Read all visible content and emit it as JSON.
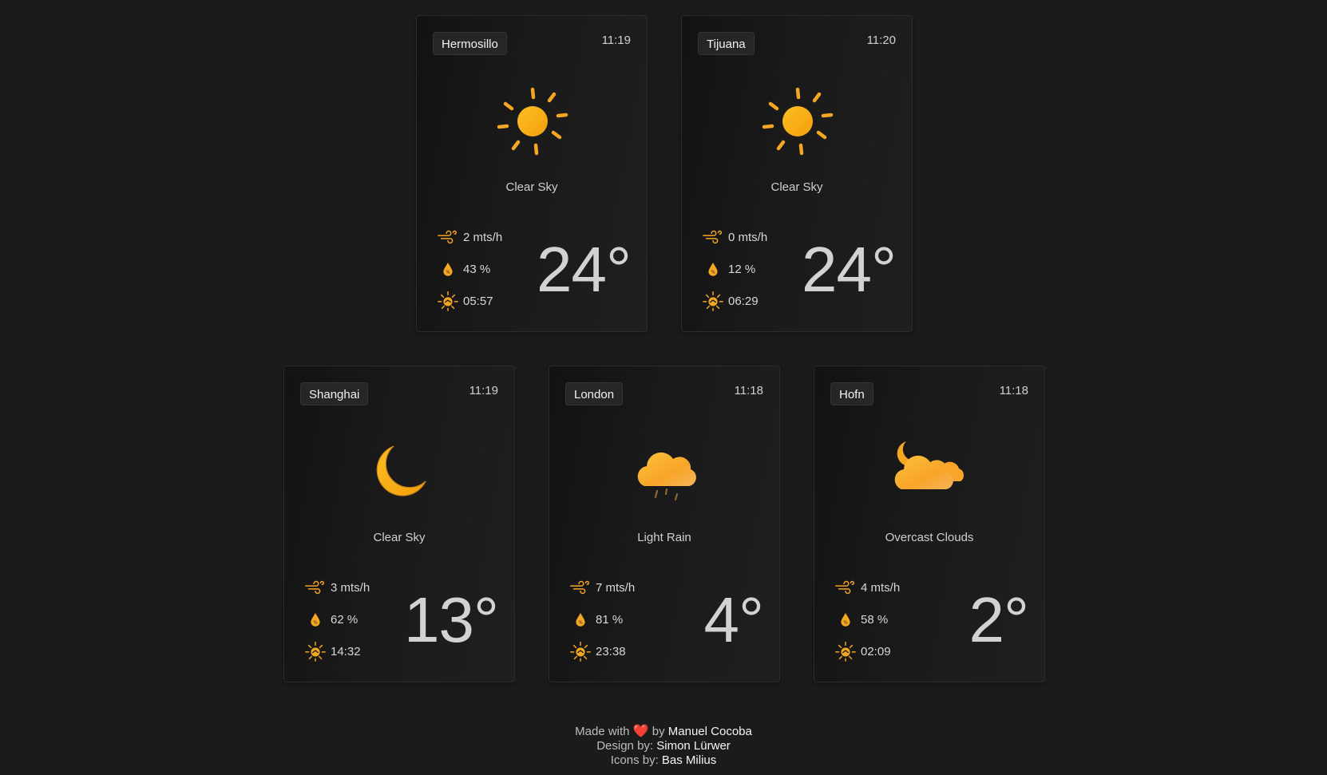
{
  "cards": [
    {
      "city": "Hermosillo",
      "time": "11:19",
      "icon": "sun-icon",
      "description": "Clear Sky",
      "wind": "2 mts/h",
      "humidity": "43 %",
      "sunrise": "05:57",
      "temperature": "24°"
    },
    {
      "city": "Tijuana",
      "time": "11:20",
      "icon": "sun-icon",
      "description": "Clear Sky",
      "wind": "0 mts/h",
      "humidity": "12 %",
      "sunrise": "06:29",
      "temperature": "24°"
    },
    {
      "city": "Shanghai",
      "time": "11:19",
      "icon": "moon-icon",
      "description": "Clear Sky",
      "wind": "3 mts/h",
      "humidity": "62 %",
      "sunrise": "14:32",
      "temperature": "13°"
    },
    {
      "city": "London",
      "time": "11:18",
      "icon": "rain-cloud-icon",
      "description": "Light Rain",
      "wind": "7 mts/h",
      "humidity": "81 %",
      "sunrise": "23:38",
      "temperature": "4°"
    },
    {
      "city": "Hofn",
      "time": "11:18",
      "icon": "overcast-night-cloud-icon",
      "description": "Overcast Clouds",
      "wind": "4 mts/h",
      "humidity": "58 %",
      "sunrise": "02:09",
      "temperature": "2°"
    }
  ],
  "footer": {
    "made_with": "Made with",
    "heart": "❤️",
    "by": "by",
    "author": "Manuel Cocoba",
    "design_label": "Design by:",
    "designer": "Simon Lürwer",
    "icons_label": "Icons by:",
    "icon_author": "Bas Milius"
  },
  "colors": {
    "background": "#1b1b1c",
    "accent": "#f5a623",
    "card": "#1a1a1b"
  }
}
